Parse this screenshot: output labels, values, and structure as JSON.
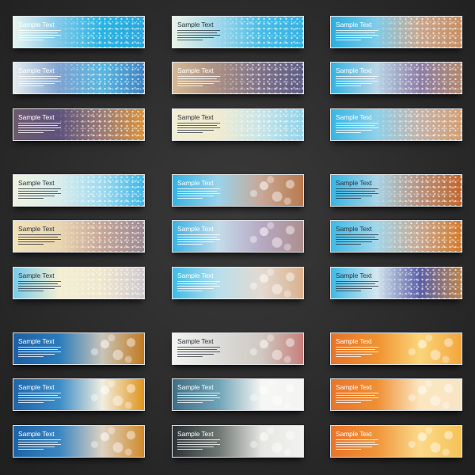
{
  "banner_title": "Sample Text",
  "groups": [
    {
      "name": "set-1",
      "rows": [
        [
          {
            "title": "Sample Text",
            "theme": "dark",
            "bg": [
              "#e8f4ef",
              "#7fc8e8",
              "#29b3e3",
              "#2aa8de"
            ],
            "effect": "sparkle"
          },
          {
            "title": "Sample Text",
            "theme": "light",
            "bg": [
              "#e9f3e6",
              "#9fd7ea",
              "#48bde6",
              "#35b2e3"
            ],
            "effect": "sparkle"
          },
          {
            "title": "Sample Text",
            "theme": "dark",
            "bg": [
              "#2aaee0",
              "#7fcce8",
              "#c9a78f",
              "#c88e62"
            ],
            "effect": "sparkle"
          }
        ],
        [
          {
            "title": "Sample Text",
            "theme": "dark",
            "bg": [
              "#e6ecef",
              "#7fa3d0",
              "#59b7e0",
              "#3f84c6"
            ],
            "effect": "sparkle"
          },
          {
            "title": "Sample Text",
            "theme": "dark",
            "bg": [
              "#d6b894",
              "#a98f84",
              "#7d7189",
              "#5e5d86"
            ],
            "effect": "sparkle"
          },
          {
            "title": "Sample Text",
            "theme": "dark",
            "bg": [
              "#33b2e2",
              "#b9d6e6",
              "#8d7ea6",
              "#b3886d"
            ],
            "effect": "sparkle"
          }
        ],
        [
          {
            "title": "Sample Text",
            "theme": "dark",
            "bg": [
              "#6e5a6e",
              "#5d527c",
              "#9d7c74",
              "#d9923a"
            ],
            "effect": "sparkle"
          },
          {
            "title": "Sample Text",
            "theme": "light",
            "bg": [
              "#f2eed3",
              "#f0ebcf",
              "#c6e4e7",
              "#8fd3ec"
            ],
            "effect": "sparkle"
          },
          {
            "title": "Sample Text",
            "theme": "dark",
            "bg": [
              "#35b6e5",
              "#8ed1ea",
              "#c4b2a9",
              "#d49e72"
            ],
            "effect": "sparkle"
          }
        ]
      ]
    },
    {
      "name": "set-2",
      "rows": [
        [
          {
            "title": "Sample Text",
            "theme": "light",
            "bg": [
              "#eef3e0",
              "#d8ecec",
              "#9fdaef",
              "#3fb8e8"
            ],
            "effect": "sparkle"
          },
          {
            "title": "Sample Text",
            "theme": "dark",
            "bg": [
              "#33b3e4",
              "#9ad3ea",
              "#c8a896",
              "#b97a4e"
            ],
            "effect": "bokeh"
          },
          {
            "title": "Sample Text",
            "theme": "light",
            "bg": [
              "#36b5e5",
              "#a6d4e6",
              "#b8927e",
              "#c2662b"
            ],
            "effect": "sparkle"
          }
        ],
        [
          {
            "title": "Sample Text",
            "theme": "light",
            "bg": [
              "#f1e2b8",
              "#e9d5b0",
              "#c6a696",
              "#9d8a94"
            ],
            "effect": "sparkle"
          },
          {
            "title": "Sample Text",
            "theme": "dark",
            "bg": [
              "#38b3e4",
              "#c3dcea",
              "#b7a9c3",
              "#ad8f8e"
            ],
            "effect": "bokeh"
          },
          {
            "title": "Sample Text",
            "theme": "light",
            "bg": [
              "#3cbbe7",
              "#a2d6e9",
              "#c7a890",
              "#d47a2a"
            ],
            "effect": "sparkle"
          }
        ],
        [
          {
            "title": "Sample Text",
            "theme": "light",
            "bg": [
              "#79cbe9",
              "#f3efd2",
              "#efe6cc",
              "#cfc9cf"
            ],
            "effect": "sparkle"
          },
          {
            "title": "Sample Text",
            "theme": "dark",
            "bg": [
              "#3fbbe7",
              "#b9dfec",
              "#e3d9d0",
              "#d9b18d"
            ],
            "effect": "bokeh"
          },
          {
            "title": "Sample Text",
            "theme": "light",
            "bg": [
              "#3eb9e6",
              "#d3e7ee",
              "#5b5fa8",
              "#b9844c"
            ],
            "effect": "sparkle"
          }
        ]
      ]
    },
    {
      "name": "set-3",
      "rows": [
        [
          {
            "title": "Sample Text",
            "theme": "dark",
            "bg": [
              "#1d5fa3",
              "#2a7cbc",
              "#c9c4b8",
              "#c27a1f"
            ],
            "effect": "bokeh"
          },
          {
            "title": "Sample Text",
            "theme": "light",
            "bg": [
              "#f3f3f1",
              "#dcdcd8",
              "#cfc9c2",
              "#c87f7a"
            ],
            "effect": "bokeh"
          },
          {
            "title": "Sample Text",
            "theme": "dark",
            "bg": [
              "#e8732a",
              "#f0922f",
              "#fbd57a",
              "#f2a63c"
            ],
            "effect": "bokeh"
          }
        ],
        [
          {
            "title": "Sample Text",
            "theme": "dark",
            "bg": [
              "#1f65a9",
              "#3b8cc7",
              "#f1eee0",
              "#e0951d"
            ],
            "effect": "bokeh"
          },
          {
            "title": "Sample Text",
            "theme": "dark",
            "bg": [
              "#3f6f86",
              "#6fa3b6",
              "#f6f6f4",
              "#f4f4f2"
            ],
            "effect": "bokeh"
          },
          {
            "title": "Sample Text",
            "theme": "dark",
            "bg": [
              "#e8752b",
              "#ef8f33",
              "#fbe6bf",
              "#f8e5c4"
            ],
            "effect": "bokeh"
          }
        ],
        [
          {
            "title": "Sample Text",
            "theme": "dark",
            "bg": [
              "#1d63a7",
              "#3a86c2",
              "#ddd2c1",
              "#d08a2a"
            ],
            "effect": "bokeh"
          },
          {
            "title": "Sample Text",
            "theme": "dark",
            "bg": [
              "#2c3236",
              "#6e7672",
              "#e6e6e2",
              "#f2f2f0"
            ],
            "effect": "bokeh"
          },
          {
            "title": "Sample Text",
            "theme": "dark",
            "bg": [
              "#e8752b",
              "#f0953a",
              "#fbd98b",
              "#f5c255"
            ],
            "effect": "bokeh"
          }
        ]
      ]
    }
  ],
  "body_line_count": 5
}
